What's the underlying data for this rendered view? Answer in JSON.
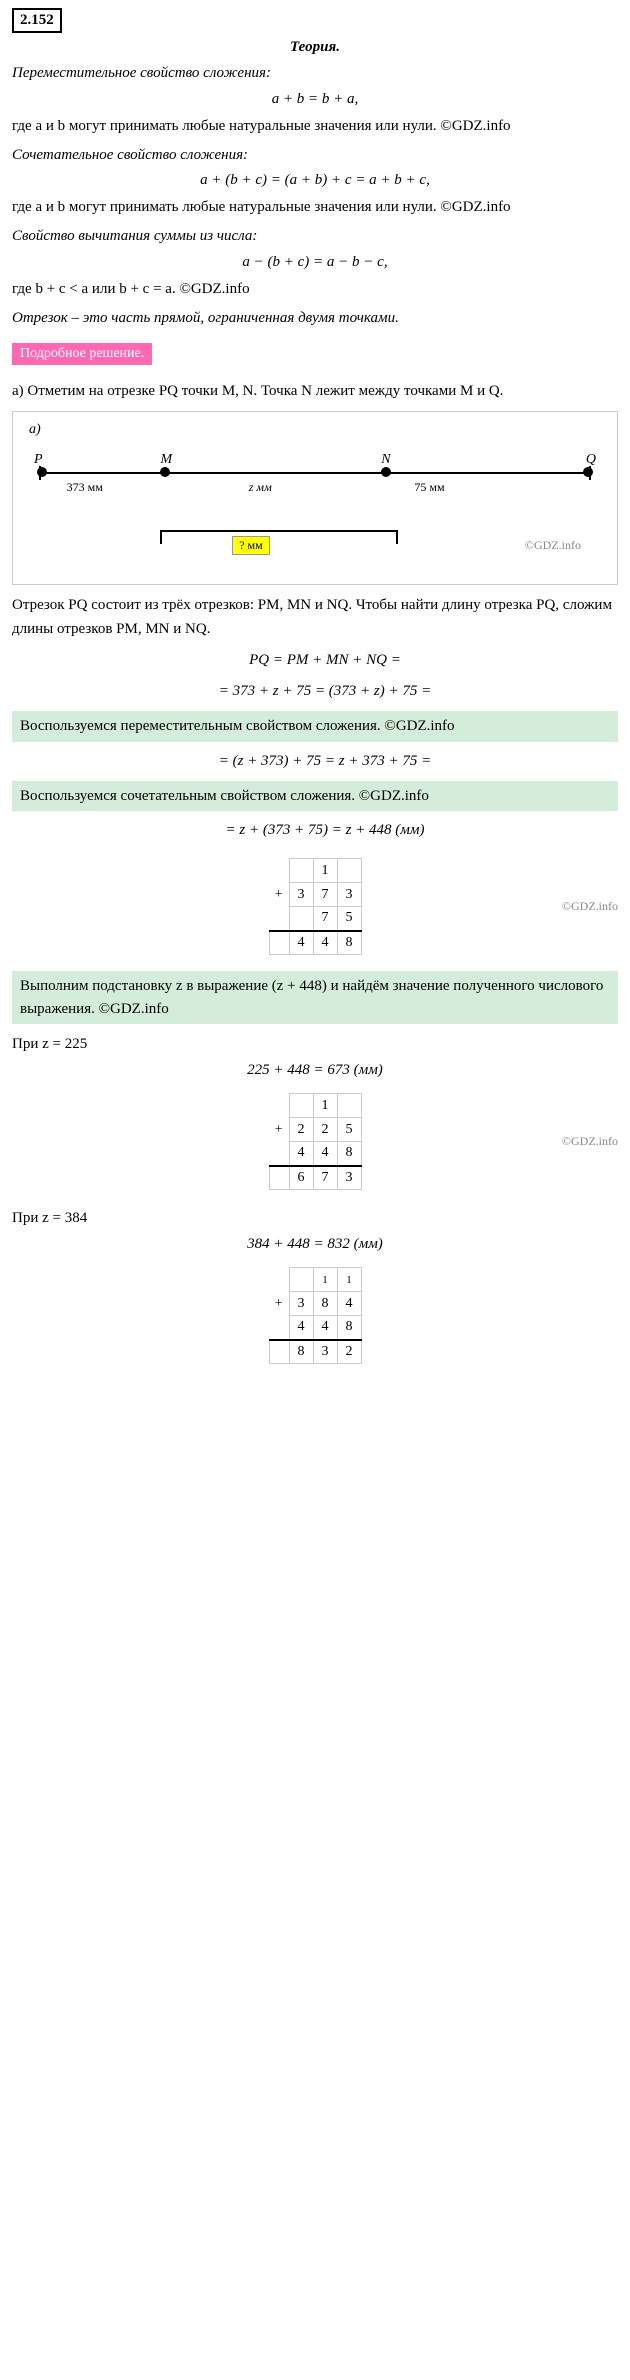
{
  "problem_number": "2.152",
  "theory": {
    "title": "Теория.",
    "sections": [
      {
        "name": "commutative",
        "title": "Переместительное свойство сложения:",
        "formula": "a + b = b + a,",
        "description": "где a и b могут принимать любые натуральные значения или нули. ©GDZ.info"
      },
      {
        "name": "associative",
        "title": "Сочетательное свойство сложения:",
        "formula": "a + (b + c) = (a + b) + c = a + b + c,",
        "description": "где a и b могут принимать любые натуральные значения или нули. ©GDZ.info"
      },
      {
        "name": "subtraction",
        "title": "Свойство вычитания суммы из числа:",
        "formula": "a − (b + c) = a − b − c,",
        "description": "где b + c < a или b + c = a. ©GDZ.info"
      },
      {
        "name": "segment",
        "title": "Отрезок – это часть прямой, ограниченная двумя точками."
      }
    ]
  },
  "solution_label": "Подробное решение.",
  "part_a": {
    "intro": "а) Отметим на отрезке PQ точки M, N. Точка N лежит между точками M и Q.",
    "diagram_label": "а)",
    "points": {
      "P": "P",
      "M": "M",
      "N": "N",
      "Q": "Q"
    },
    "measures": {
      "PM": "373 мм",
      "MN": "z мм",
      "NQ": "75 мм",
      "question": "? мм"
    },
    "gdz_watermark": "©GDZ.info",
    "step1_text": "Отрезок PQ состоит из трёх отрезков: PM, MN и NQ. Чтобы найти длину отрезка PQ, сложим длины отрезков PM, MN и NQ.",
    "formula1": "PQ = PM + MN + NQ =",
    "formula2": "= 373 + z + 75 = (373 + z) + 75 =",
    "green1_text": "Воспользуемся переместительным свойством сложения. ©GDZ.info",
    "formula3": "= (z + 373) + 75 = z + 373 + 75 =",
    "green2_text": "Воспользуемся сочетательным свойством сложения. ©GDZ.info",
    "formula4": "= z + (373 + 75) = z + 448 (мм)",
    "addition_373_75": {
      "carry": "1",
      "row1": [
        "3",
        "7",
        "3"
      ],
      "row2": [
        "7",
        "5"
      ],
      "result": [
        "4",
        "4",
        "8"
      ],
      "op": "+"
    },
    "gdz_info_1": "©GDZ.info",
    "step2_text": "Выполним подстановку z в выражение (z + 448) и найдём значение полученного числового выражения. ©GDZ.info",
    "case1": {
      "condition": "При z = 225",
      "formula": "225 + 448 = 673 (мм)",
      "addition": {
        "carry": "1",
        "row1": [
          "2",
          "2",
          "5"
        ],
        "row2": [
          "4",
          "4",
          "8"
        ],
        "result": [
          "6",
          "7",
          "3"
        ],
        "op": "+"
      },
      "gdz_info": "©GDZ.info"
    },
    "case2": {
      "condition": "При z = 384",
      "formula": "384 + 448 = 832 (мм)",
      "addition": {
        "carry": "1 1",
        "row1": [
          "3",
          "8",
          "4"
        ],
        "row2": [
          "4",
          "4",
          "8"
        ],
        "result": [
          "8",
          "3",
          "2"
        ],
        "op": "+"
      }
    }
  }
}
